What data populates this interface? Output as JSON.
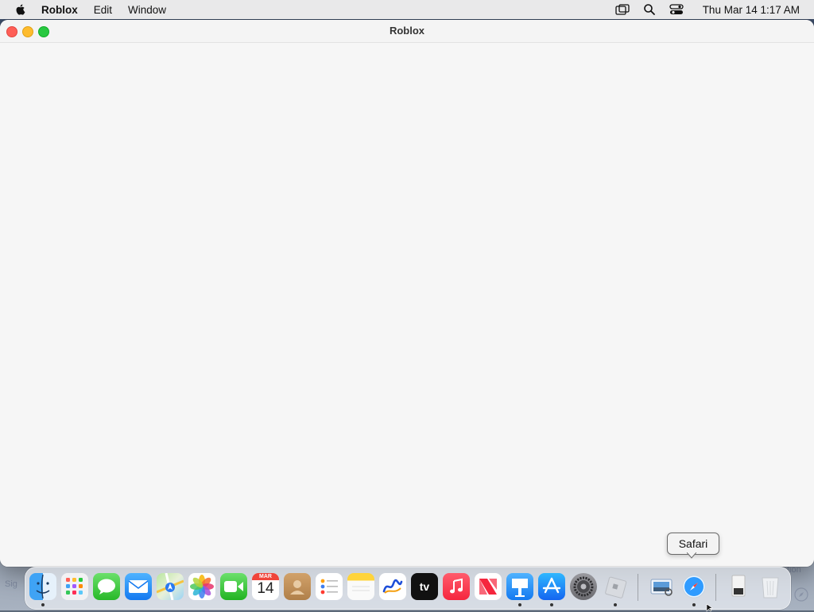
{
  "menubar": {
    "app_name": "Roblox",
    "items": [
      "Edit",
      "Window"
    ],
    "clock": "Thu Mar 14  1:17 AM",
    "status_icons": [
      "screen-mirroring-icon",
      "spotlight-search-icon",
      "control-center-icon"
    ]
  },
  "window": {
    "title": "Roblox"
  },
  "dock": {
    "apps": [
      {
        "name": "Finder",
        "icon": "finder-icon",
        "running": true
      },
      {
        "name": "Launchpad",
        "icon": "launchpad-icon",
        "running": false
      },
      {
        "name": "Messages",
        "icon": "messages-icon",
        "running": false
      },
      {
        "name": "Mail",
        "icon": "mail-icon",
        "running": false
      },
      {
        "name": "Maps",
        "icon": "maps-icon",
        "running": false
      },
      {
        "name": "Photos",
        "icon": "photos-icon",
        "running": false
      },
      {
        "name": "FaceTime",
        "icon": "facetime-icon",
        "running": false
      },
      {
        "name": "Calendar",
        "icon": "calendar-icon",
        "running": false,
        "month": "MAR",
        "day": "14"
      },
      {
        "name": "Contacts",
        "icon": "contacts-icon",
        "running": false
      },
      {
        "name": "Reminders",
        "icon": "reminders-icon",
        "running": false
      },
      {
        "name": "Notes",
        "icon": "notes-icon",
        "running": false
      },
      {
        "name": "Freeform",
        "icon": "freeform-icon",
        "running": false
      },
      {
        "name": "TV",
        "icon": "apple-tv-icon",
        "running": false,
        "label": "tv"
      },
      {
        "name": "Music",
        "icon": "music-icon",
        "running": false
      },
      {
        "name": "News",
        "icon": "news-icon",
        "running": false
      },
      {
        "name": "Keynote",
        "icon": "keynote-icon",
        "running": true
      },
      {
        "name": "App Store",
        "icon": "app-store-icon",
        "running": true
      },
      {
        "name": "System Settings",
        "icon": "system-settings-icon",
        "running": false
      },
      {
        "name": "Roblox",
        "icon": "roblox-icon",
        "running": true
      },
      {
        "name": "Preview",
        "icon": "preview-icon",
        "running": false
      },
      {
        "name": "Safari",
        "icon": "safari-icon",
        "running": true
      },
      {
        "name": "Downloads",
        "icon": "downloads-folder-icon",
        "running": false
      },
      {
        "name": "Trash",
        "icon": "trash-icon",
        "running": false
      }
    ],
    "tooltip": "Safari"
  },
  "colors": {
    "close": "#fe5f57",
    "minimize": "#febc2e",
    "maximize": "#28c840",
    "window_bg": "#f6f6f6"
  }
}
